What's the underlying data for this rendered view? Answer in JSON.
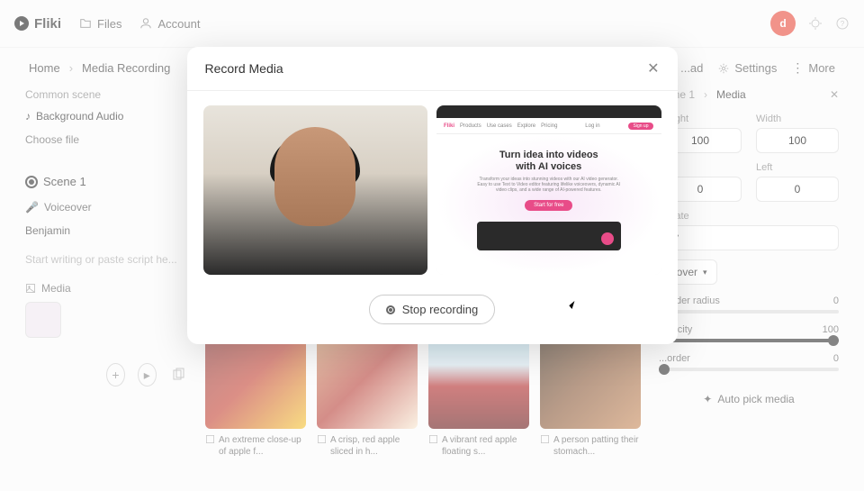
{
  "nav": {
    "brand": "Fliki",
    "files": "Files",
    "account": "Account",
    "avatar_initial": "d"
  },
  "breadcrumb": {
    "home": "Home",
    "recording": "Media Recording"
  },
  "actions": {
    "download": "...ad",
    "settings": "Settings",
    "more": "More"
  },
  "left": {
    "common_scene": "Common scene",
    "bg_audio": "Background Audio",
    "choose_file": "Choose file",
    "scene": "Scene 1",
    "voiceover": "Voiceover",
    "voice_name": "Benjamin",
    "script_placeholder": "Start writing or paste script he...",
    "media": "Media"
  },
  "media_items": [
    {
      "caption": "An extreme close-up of apple f..."
    },
    {
      "caption": "A crisp, red apple sliced in h..."
    },
    {
      "caption": "A vibrant red apple floating s..."
    },
    {
      "caption": "A person patting their stomach..."
    }
  ],
  "right": {
    "tab_scene": "...ene 1",
    "tab_media": "Media",
    "height_label": "...eight",
    "height_value": "100",
    "width_label": "Width",
    "width_value": "100",
    "top_label": "...p",
    "top_value": "0",
    "left_label": "Left",
    "left_value": "0",
    "rotate_label": "...otate",
    "rotate_value": "0°",
    "fit_label": "...",
    "fit_value": "Cover",
    "border_radius_label": "...order radius",
    "border_radius_value": "0",
    "opacity_label": "Opacity",
    "opacity_value": "100",
    "border_label": "...order",
    "border_value": "0",
    "auto_pick": "Auto pick media"
  },
  "modal": {
    "title": "Record Media",
    "stop": "Stop recording",
    "hero_title_1": "Turn idea into videos",
    "hero_title_2": "with AI voices",
    "hero_sub": "Transform your ideas into stunning videos with our AI video generator. Easy to use Text to Video editor featuring lifelike voiceovers, dynamic AI video clips, and a wide range of AI-powered features.",
    "hero_cta": "Start for free",
    "screen_brand": "Fliki",
    "screen_login": "Log in",
    "screen_signup": "Sign up"
  }
}
